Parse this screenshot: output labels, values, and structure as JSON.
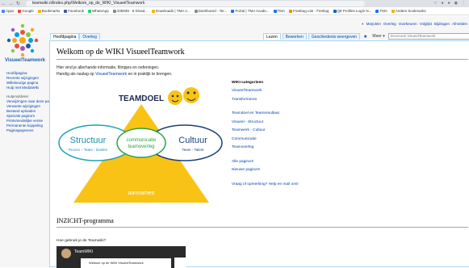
{
  "browser": {
    "url": "teamwiki.nl/index.php/Welkom_op_de_WIKI_VisueelTeamwork",
    "bookmarks": [
      "Apps",
      "Google",
      "Bookmarks",
      "Facebook",
      "WhatsApp",
      "205939 - 8 Divad...",
      "Downloads | TMA A...",
      "Dashboard - Ter...",
      "Portal | TMA Acade...",
      "TMA",
      "Freebug Lite - Firebug",
      "Q8 Profiles Login N...",
      "TMA",
      "Andere bookmarks"
    ]
  },
  "personal_tools": [
    "Marjolein",
    "Overleg",
    "Voorkeuren",
    "Volglijst",
    "Bijdragen",
    "Afmelden"
  ],
  "logo": {
    "text": "VisueelTeamwork"
  },
  "sidebar": {
    "nav": [
      "Hoofdpagina",
      "Recente wijzigingen",
      "Willekeurige pagina",
      "Hulp met MediaWiki"
    ],
    "tools_heading": "Hulpmiddelen",
    "tools": [
      "Verwijzingen naar deze pagina",
      "Verwante wijzigingen",
      "Bestand uploaden",
      "Speciale pagina's",
      "Printvriendelijke versie",
      "Permanente koppeling",
      "Paginagegevens"
    ]
  },
  "tabs": {
    "left": [
      "Hoofdpagina",
      "Overleg"
    ],
    "right": [
      "Lezen",
      "Bewerken",
      "Geschiedenis weergeven"
    ],
    "more": "Meer",
    "search_placeholder": "Doorzoek VisueelTeamwork"
  },
  "content": {
    "title": "Welkom op de WIKI VisueelTeamwork",
    "intro_line1": "Hier vind je allerhande informatie, filmpjes en oefeningen.",
    "intro_line2_pre": "Handig als naslag op ",
    "intro_line2_link": "VisueelTeamwork",
    "intro_line2_post": " en in praktijk te brengen.",
    "section2_title": "INZICHT-programma",
    "howto": "Hoe gebruik je de Teamwiki?"
  },
  "diagram": {
    "teamdoel": "TEAMDOEL",
    "structuur": "Structuur",
    "structuur_sub": "Proces – Team - Doelen",
    "communicatie": "communicatie",
    "teamoverleg": "teamoverleg",
    "cultuur": "Cultuur",
    "cultuur_sub": "Team - Talent",
    "aannames": "aannames"
  },
  "categories": {
    "title": "WIKI-categorieen",
    "group1": [
      "VisueelTeamwork",
      "Transformeren"
    ],
    "group2": [
      "Teamdoel en Teamresultaat",
      "Visueel - Structuur",
      "Teamwerk - Cultuur",
      "Communicatie",
      "Teamoverleg"
    ],
    "group3": [
      "Alle pagina's",
      "Nieuwe pagina's"
    ],
    "footer": "Vraag of opmerking? Help en mail ons!"
  },
  "video": {
    "channel": "TeamWIKI",
    "doc_title": "Welkom op de WIKI VisueelTeamwork"
  }
}
